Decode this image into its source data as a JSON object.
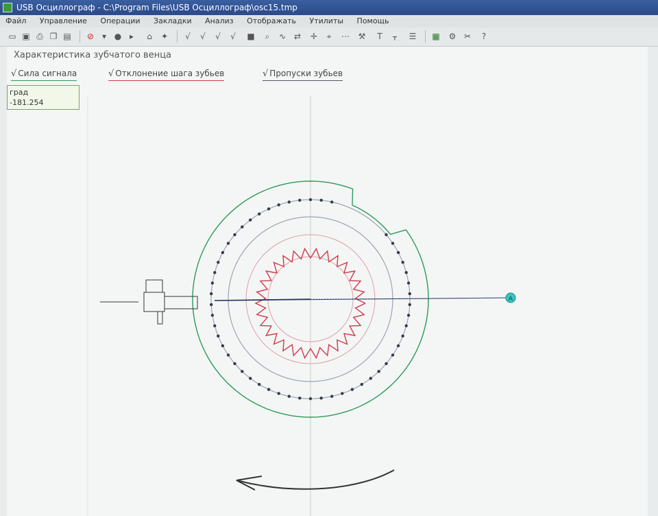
{
  "window": {
    "title": "USB Осциллограф - C:\\Program Files\\USB Осциллограф\\osc15.tmp"
  },
  "menu": [
    "Файл",
    "Управление",
    "Операции",
    "Закладки",
    "Анализ",
    "Отображать",
    "Утилиты",
    "Помощь"
  ],
  "panel": {
    "title": "Характеристика зубчатого венца",
    "checks": {
      "signal": "Сила сигнала",
      "deviation": "Отклонение шага зубьев",
      "missing": "Пропуски зубьев"
    },
    "readout": {
      "label": "град",
      "value": "-181.254"
    },
    "marker_label": "A"
  },
  "colors": {
    "accent_green": "#2a9a5a",
    "deviation_red": "#d03a4a",
    "marker": "#36c7c0"
  }
}
